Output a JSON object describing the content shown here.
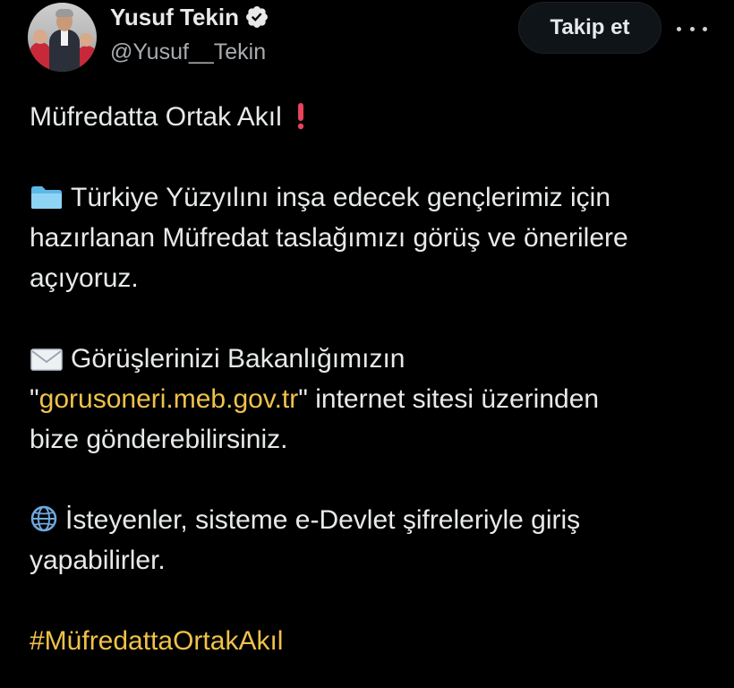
{
  "author": {
    "display_name": "Yusuf Tekin",
    "handle": "@Yusuf__Tekin",
    "verified_icon": "verified-badge-icon"
  },
  "actions": {
    "follow_label": "Takip et",
    "more_icon": "more-options-icon"
  },
  "post": {
    "title": "Müfredatta Ortak Akıl",
    "title_emoji": "red-exclamation-icon",
    "p1_emoji": "folder-icon",
    "p1_line1": "Türkiye Yüzyılını inşa edecek gençlerimiz için",
    "p1_line2": "hazırlanan Müfredat taslağımızı görüş ve önerilere",
    "p1_line3": "açıyoruz.",
    "p2_emoji": "envelope-icon",
    "p2_line1": "Görüşlerinizi Bakanlığımızın",
    "p2_quote_open": "\"",
    "p2_link": "gorusoneri.meb.gov.tr",
    "p2_after_link": "\" internet sitesi üzerinden",
    "p2_line3": "bize gönderebilirsiniz.",
    "p3_emoji": "globe-icon",
    "p3_line1": "İsteyenler, sisteme e-Devlet şifreleriyle giriş",
    "p3_line2": "yapabilirler.",
    "hashtag": "#MüfredattaOrtakAkıl"
  },
  "colors": {
    "background": "#000000",
    "text": "#e7e9ea",
    "secondary_text": "#a8acb0",
    "link": "#f0c24a",
    "verified": "#e7e9ea"
  }
}
